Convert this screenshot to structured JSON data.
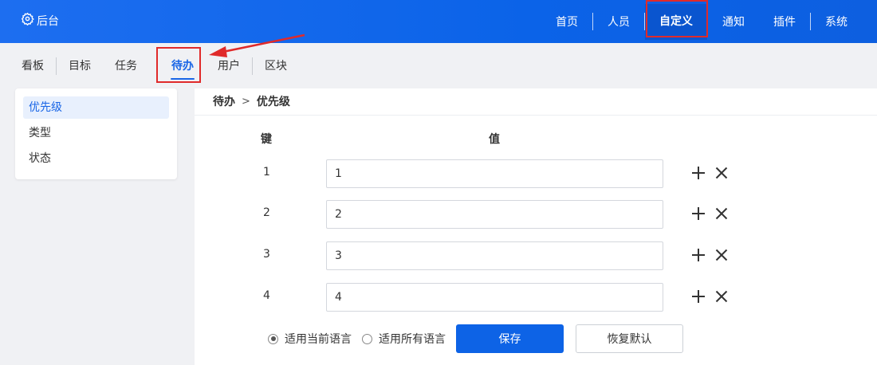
{
  "header": {
    "brand": "后台",
    "nav": [
      "首页",
      "人员",
      "自定义",
      "通知",
      "插件",
      "系统"
    ]
  },
  "subnav": {
    "tabs": [
      "看板",
      "目标",
      "任务",
      "待办",
      "用户",
      "区块"
    ]
  },
  "sidebar": {
    "items": [
      "优先级",
      "类型",
      "状态"
    ]
  },
  "breadcrumb": {
    "parent": "待办",
    "separator": ">",
    "current": "优先级"
  },
  "table": {
    "key_header": "键",
    "value_header": "值",
    "rows": [
      {
        "key": "1",
        "value": "1"
      },
      {
        "key": "2",
        "value": "2"
      },
      {
        "key": "3",
        "value": "3"
      },
      {
        "key": "4",
        "value": "4"
      }
    ]
  },
  "footer": {
    "radio_current": "适用当前语言",
    "radio_all": "适用所有语言",
    "save_label": "保存",
    "reset_label": "恢复默认"
  },
  "colors": {
    "primary": "#0d63e6",
    "header_bg": "#1d6ef0",
    "highlight": "#e02a2a"
  },
  "icons": {
    "brand": "gear-icon",
    "add": "plus-icon",
    "remove": "close-icon"
  }
}
